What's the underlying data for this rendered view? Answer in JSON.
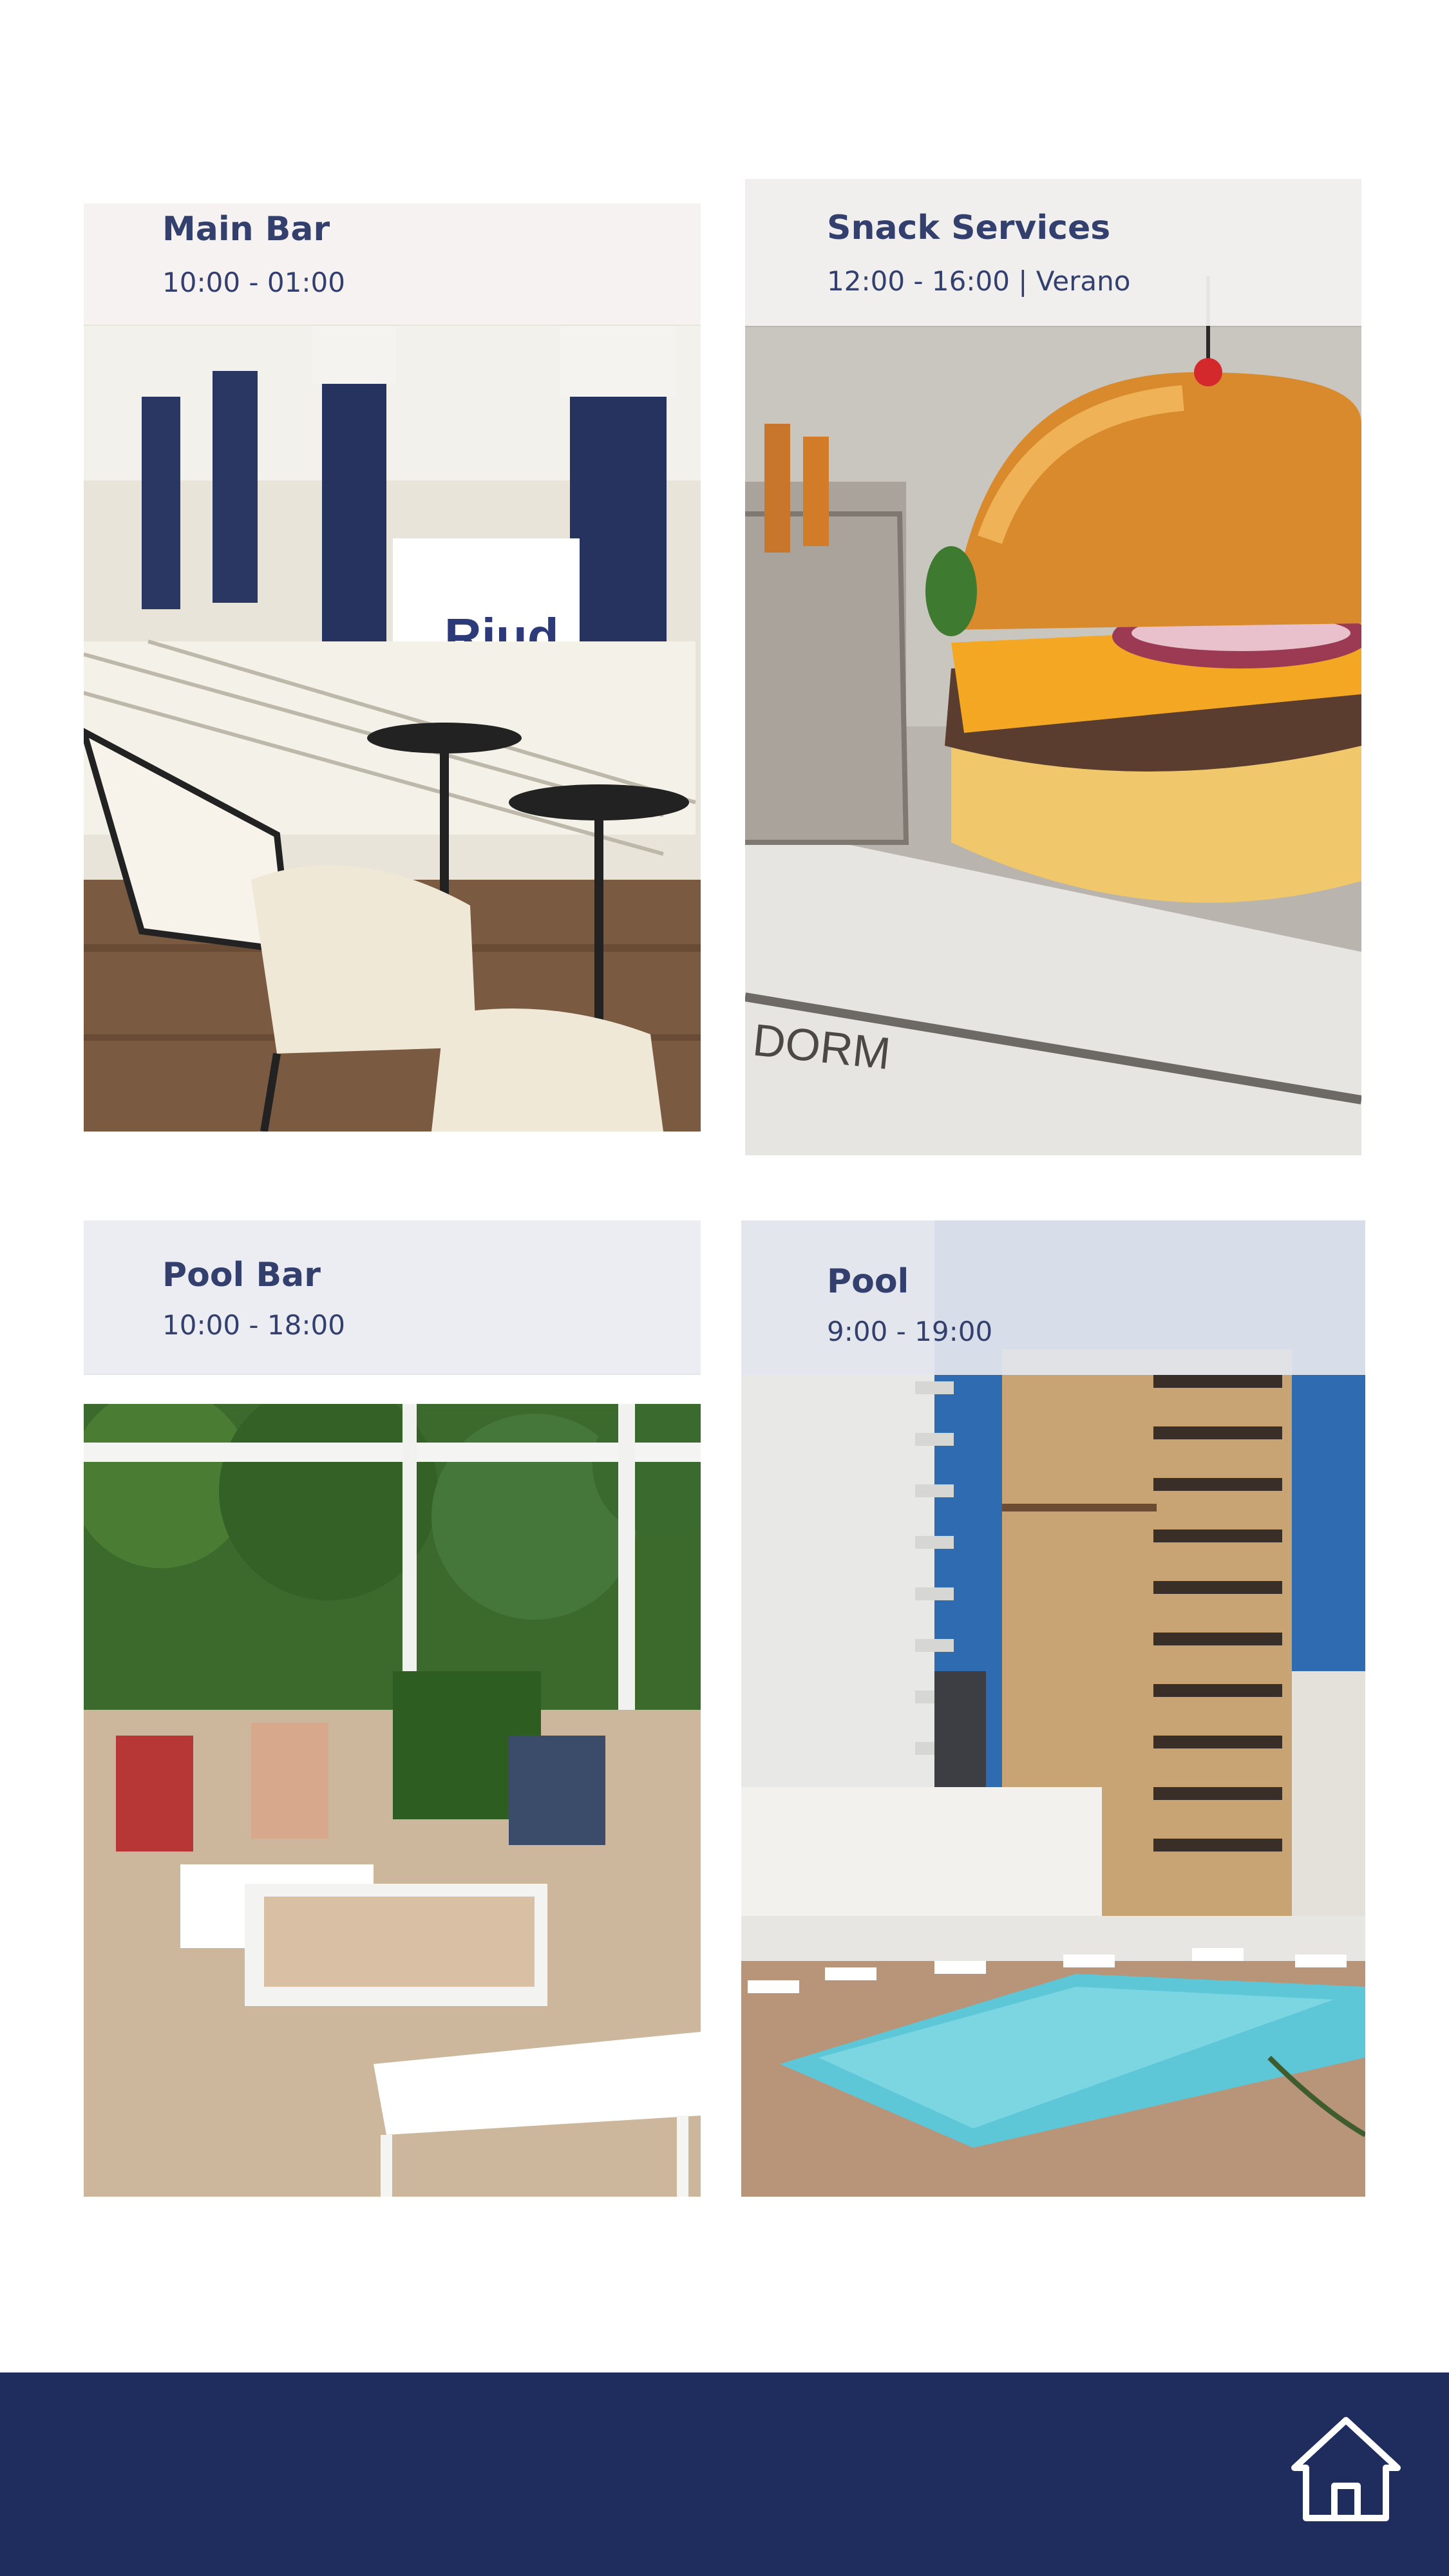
{
  "cards": [
    {
      "title": "Main Bar",
      "hours": "10:00 - 01:00"
    },
    {
      "title": "Snack Services",
      "hours": "12:00 - 16:00 | Verano"
    },
    {
      "title": "Pool Bar",
      "hours": "10:00 - 18:00"
    },
    {
      "title": "Pool",
      "hours": "9:00 - 19:00"
    }
  ],
  "footer": {
    "home_icon": "home-icon"
  },
  "colors": {
    "brand_navy": "#1f2c5e",
    "title_text": "#33406e",
    "caption_bg": "#f5f3f2"
  }
}
